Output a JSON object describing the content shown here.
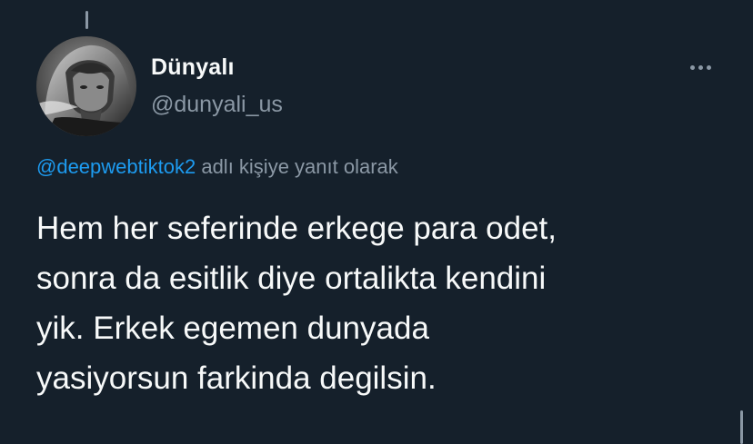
{
  "tweet": {
    "author": {
      "display_name": "Dünyalı",
      "handle": "@dunyali_us",
      "avatar_icon": "profile-photo"
    },
    "more_icon": "more-horizontal-icon",
    "reply_to": {
      "mention": "@deepwebtiktok2",
      "suffix": " adlı kişiye yanıt olarak"
    },
    "text": "Hem her seferinde erkege para odet,\nsonra da esitlik diye ortalikta kendini\nyik. Erkek egemen dunyada\nyasiyorsun farkinda degilsin."
  },
  "colors": {
    "background": "#15202b",
    "primary_text": "#f7f9f9",
    "secondary_text": "#8b98a5",
    "accent": "#1d9bf0"
  }
}
